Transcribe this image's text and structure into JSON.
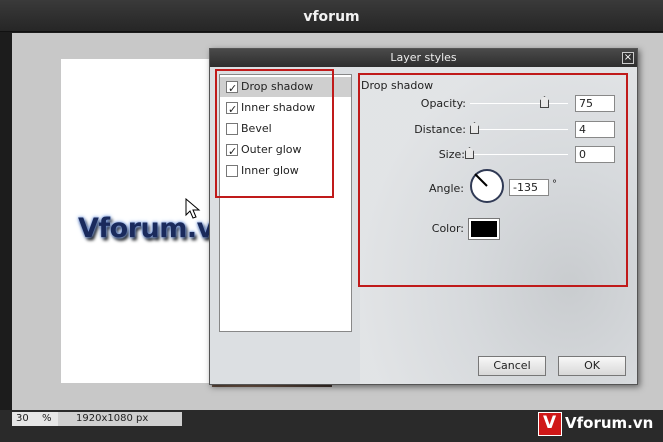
{
  "app": {
    "title": "vforum"
  },
  "canvas": {
    "overlay_text": "Vforum.vn"
  },
  "status_bar": {
    "zoom_value": "30",
    "zoom_unit": "%",
    "image_size": "1920x1080 px"
  },
  "watermark": {
    "logo_letter": "V",
    "text": "Vforum.vn"
  },
  "dialog": {
    "title": "Layer styles",
    "close_glyph": "×",
    "styles": [
      {
        "label": "Drop shadow",
        "checked": true,
        "selected": true
      },
      {
        "label": "Inner shadow",
        "checked": true,
        "selected": false
      },
      {
        "label": "Bevel",
        "checked": false,
        "selected": false
      },
      {
        "label": "Outer glow",
        "checked": true,
        "selected": false
      },
      {
        "label": "Inner glow",
        "checked": false,
        "selected": false
      }
    ],
    "panel": {
      "section_title": "Drop shadow",
      "opacity_label": "Opacity:",
      "opacity_value": "75",
      "distance_label": "Distance:",
      "distance_value": "4",
      "size_label": "Size:",
      "size_value": "0",
      "angle_label": "Angle:",
      "angle_value": "-135",
      "angle_unit": "°",
      "color_label": "Color:",
      "color_value": "#000000"
    },
    "buttons": {
      "cancel": "Cancel",
      "ok": "OK"
    }
  },
  "colors": {
    "highlight_red": "#c01a1a",
    "title_bar": "#2e2e2e",
    "dialog_bg": "#dcdfe2"
  },
  "icons": {
    "cursor": "arrow-cursor-icon",
    "close": "close-icon",
    "dial": "angle-dial-icon"
  }
}
